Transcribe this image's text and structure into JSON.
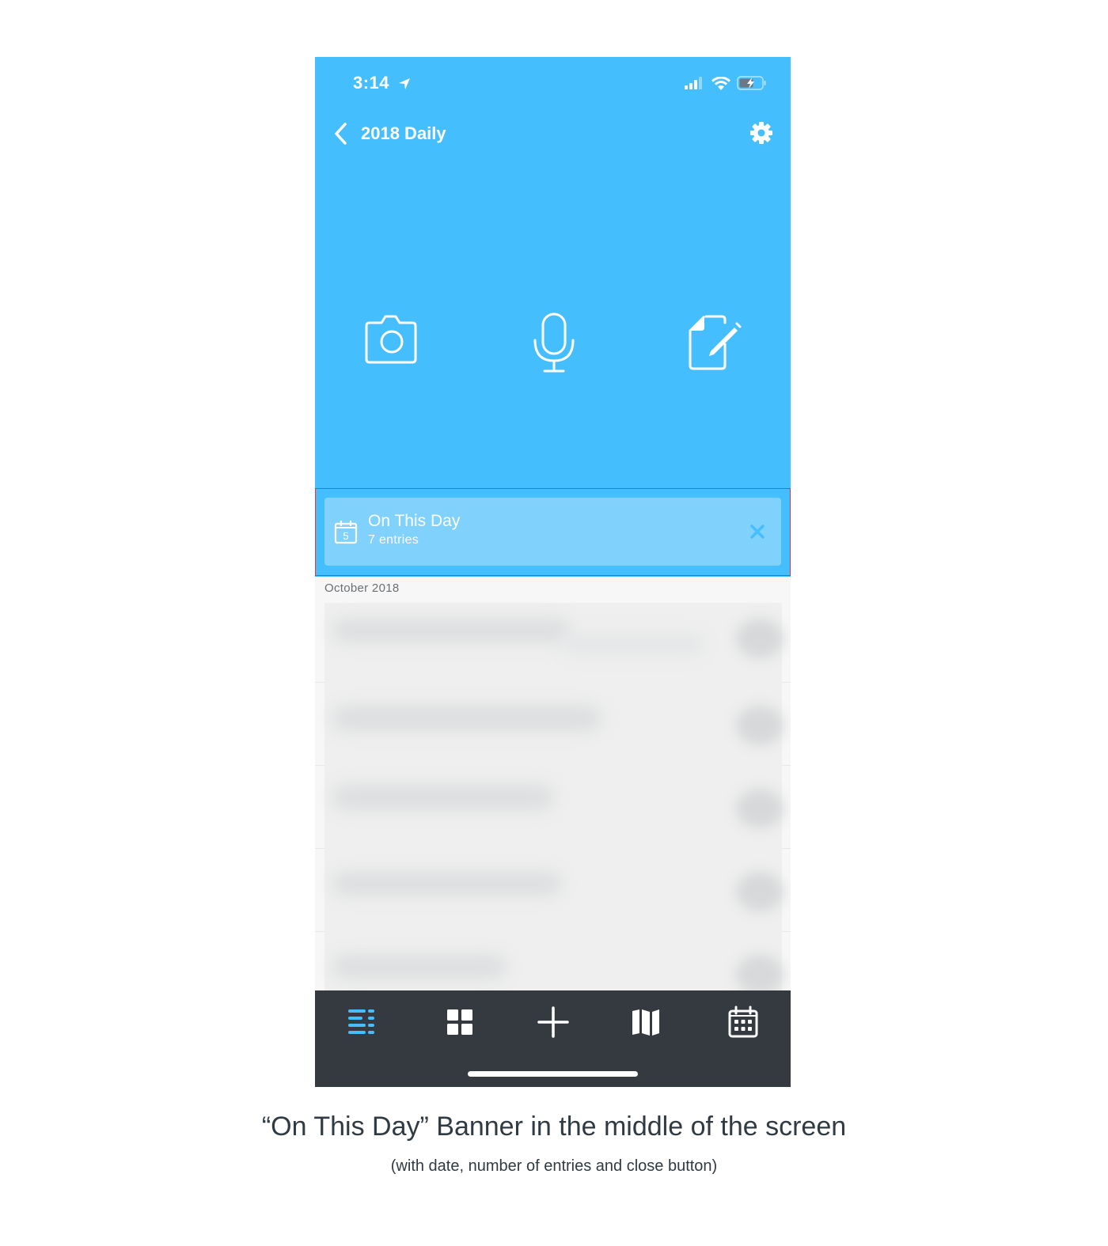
{
  "status_bar": {
    "time": "3:14",
    "location_icon": "location-arrow-icon",
    "signal_icon": "cellular-signal-icon",
    "wifi_icon": "wifi-icon",
    "battery_icon": "battery-charging-icon"
  },
  "nav": {
    "back_icon": "chevron-left-icon",
    "title": "2018 Daily",
    "settings_icon": "gear-icon"
  },
  "actions": [
    {
      "name": "camera",
      "icon": "camera-icon"
    },
    {
      "name": "audio",
      "icon": "microphone-icon"
    },
    {
      "name": "text",
      "icon": "edit-document-icon"
    }
  ],
  "banner": {
    "icon": "calendar-icon",
    "calendar_day": "5",
    "title": "On This Day",
    "subtitle": "7 entries",
    "close_icon": "close-icon"
  },
  "list": {
    "section_header": "October 2018",
    "entry_count_visible": 5
  },
  "tabbar": {
    "tabs": [
      {
        "name": "list",
        "icon": "list-icon",
        "active": true
      },
      {
        "name": "media",
        "icon": "grid-icon",
        "active": false
      },
      {
        "name": "new-entry",
        "icon": "plus-icon",
        "active": false
      },
      {
        "name": "map",
        "icon": "map-icon",
        "active": false
      },
      {
        "name": "calendar",
        "icon": "calendar-icon",
        "active": false
      }
    ],
    "active_color": "#45befd"
  },
  "colors": {
    "accent": "#45befd",
    "banner": "#80d2fd",
    "tabbar": "#343a40",
    "highlight": "#e53935"
  },
  "caption": {
    "title": "“On This Day” Banner in the middle of the screen",
    "subtitle": "(with date, number of entries and close button)"
  }
}
